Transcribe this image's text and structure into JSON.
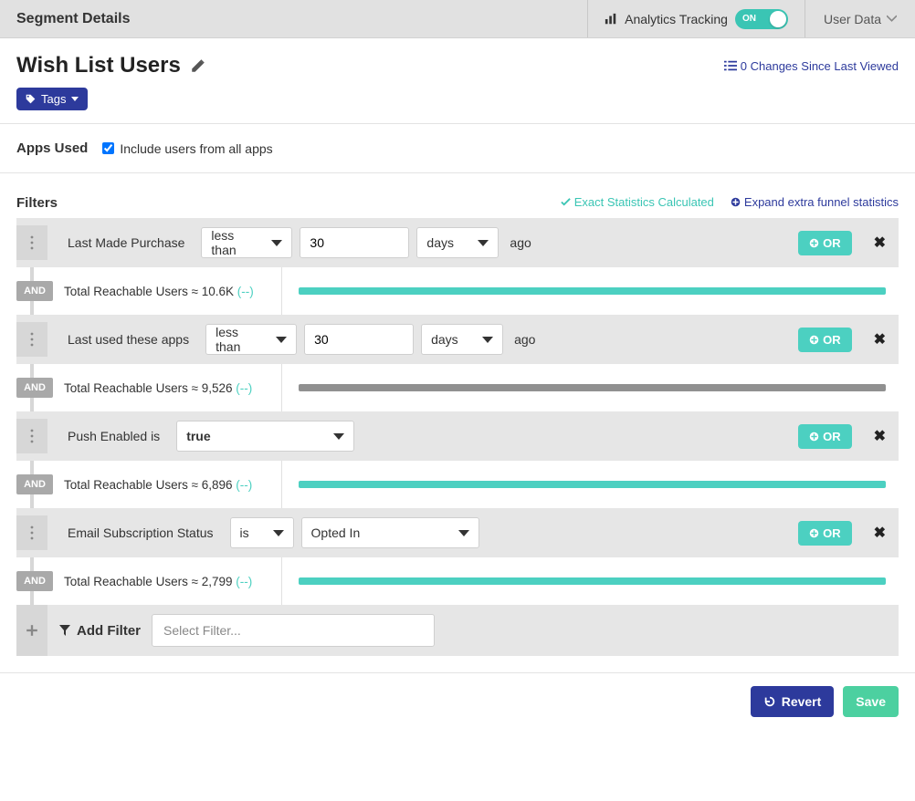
{
  "topbar": {
    "title": "Segment Details",
    "tracking_label": "Analytics Tracking",
    "toggle_text": "ON",
    "user_data": "User Data"
  },
  "segment": {
    "name": "Wish List Users",
    "changes_text": "0 Changes Since Last Viewed"
  },
  "tags": {
    "label": "Tags"
  },
  "apps": {
    "label": "Apps Used",
    "checkbox_label": "Include users from all apps"
  },
  "filters": {
    "label": "Filters",
    "stats_calc": "Exact Statistics Calculated",
    "expand_label": "Expand extra funnel statistics",
    "or_label": "OR",
    "and_label": "AND",
    "ago_label": "ago",
    "reach_prefix": "Total Reachable Users ≈ ",
    "reach_extra": "(--)",
    "add_label": "Add Filter",
    "add_select_placeholder": "Select Filter...",
    "items": [
      {
        "label": "Last Made Purchase",
        "operator": "less than",
        "value": "30",
        "unit": "days",
        "show_ago": true,
        "reach_value": "10.6K",
        "bar_color": "teal"
      },
      {
        "label": "Last used these apps",
        "operator": "less than",
        "value": "30",
        "unit": "days",
        "show_ago": true,
        "reach_value": "9,526",
        "bar_color": "gray"
      },
      {
        "label": "Push Enabled is",
        "operator": null,
        "value": "true",
        "value_style": "select_wide",
        "unit": null,
        "show_ago": false,
        "reach_value": "6,896",
        "bar_color": "teal"
      },
      {
        "label": "Email Subscription Status",
        "operator": "is",
        "value": "Opted In",
        "value_style": "select_wide",
        "unit": null,
        "show_ago": false,
        "reach_value": "2,799",
        "bar_color": "teal"
      }
    ]
  },
  "footer": {
    "revert": "Revert",
    "save": "Save"
  }
}
